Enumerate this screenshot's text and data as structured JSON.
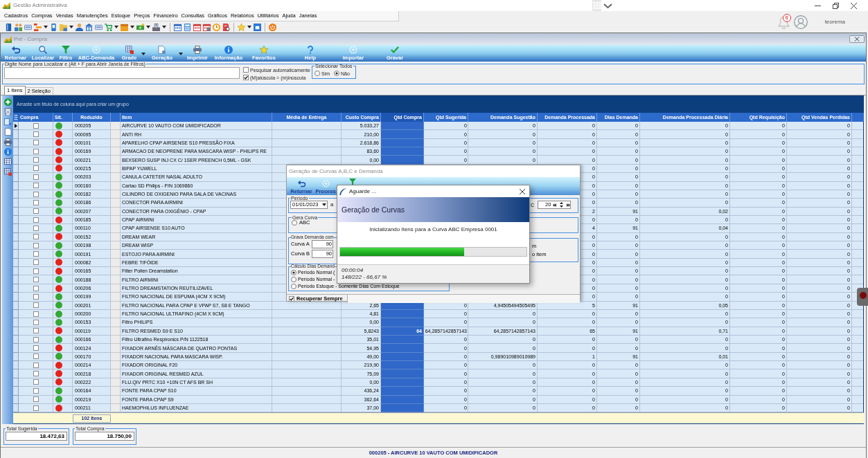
{
  "window": {
    "title": "Gestão Administrativa",
    "notifications": "0",
    "user": "teorema"
  },
  "menu": [
    "Cadastros",
    "Compras",
    "Vendas",
    "Manutenções",
    "Estoque",
    "Preços",
    "Financeiro",
    "Consultas",
    "Gráficos",
    "Relatórios",
    "Utilitários",
    "Ajuda",
    "Janelas"
  ],
  "toolbar": [
    [
      {
        "dropdown": false
      },
      {
        "dropdown": false
      },
      {
        "dropdown": false
      },
      {
        "dropdown": true
      },
      {
        "dropdown": false
      },
      {
        "dropdown": true
      },
      {
        "dropdown": false
      },
      {
        "dropdown": false
      },
      {
        "dropdown": false
      },
      {
        "dropdown": true
      },
      {
        "dropdown": true
      },
      {
        "dropdown": true
      },
      {
        "dropdown": true
      }
    ],
    [
      {
        "dropdown": false
      },
      {
        "dropdown": false
      },
      {
        "dropdown": false
      },
      {
        "dropdown": false
      },
      {
        "dropdown": false
      },
      {
        "dropdown": false
      }
    ],
    [
      {
        "dropdown": true
      },
      {
        "dropdown": false
      }
    ],
    [
      {
        "dropdown": false
      }
    ]
  ],
  "child_window": {
    "title": "Pré - Compra",
    "toolbar": [
      {
        "label": "Retornar",
        "dropdown": false
      },
      {
        "label": "Localizar",
        "dropdown": false
      },
      {
        "label": "Filtro",
        "dropdown": false
      },
      {
        "label": "ABC-Demanda",
        "dropdown": false
      },
      {
        "label": "Grade",
        "dropdown": true
      },
      {
        "label": "Geração",
        "dropdown": true
      },
      {
        "label": "Imprimir",
        "dropdown": false
      },
      {
        "label": "Informação",
        "dropdown": false
      },
      {
        "label": "Favoritos",
        "dropdown": false
      },
      {
        "label": "Help",
        "dropdown": false
      },
      {
        "label": "Importar",
        "dropdown": false
      },
      {
        "label": "Gravar",
        "dropdown": false
      }
    ]
  },
  "search": {
    "legend": "Digite Nome para Localizar e (Alt + F para Abrir Janela de Filtros)",
    "options": [
      {
        "label": "Pesquisar automaticamente",
        "checked": false
      },
      {
        "label": "(M)aiúscula = (m)inúscula",
        "checked": true
      }
    ],
    "select_all": {
      "legend": "Selecionar Todos",
      "options": [
        {
          "label": "Sim",
          "selected": false
        },
        {
          "label": "Não",
          "selected": true
        }
      ]
    }
  },
  "tabs": [
    {
      "label": "1 Itens",
      "selected": true
    },
    {
      "label": "2 Seleção",
      "selected": false
    }
  ],
  "grid": {
    "group_hint": "Arraste um título de coluna aqui para criar um grupo",
    "columns": [
      {
        "label": "Compra",
        "selected": false
      },
      {
        "label": "Sit.",
        "selected": false
      },
      {
        "label": "Reduzido",
        "selected": false
      },
      {
        "label": "Item",
        "selected": false
      },
      {
        "label": "Média de Entrega",
        "selected": false
      },
      {
        "label": "Custo Compra",
        "selected": false
      },
      {
        "label": "Qtd Compra",
        "selected": true
      },
      {
        "label": "Qtd Sugerida",
        "selected": false
      },
      {
        "label": "Demanda Sugestão",
        "selected": false
      },
      {
        "label": "Demanda Processada",
        "selected": false
      },
      {
        "label": "Dias Demanda",
        "selected": false
      },
      {
        "label": "Demanda Processada Diária",
        "selected": false
      },
      {
        "label": "Qtd Requisição",
        "selected": false
      },
      {
        "label": "Qtd Vendas Perdidas",
        "selected": false
      }
    ],
    "rows": [
      {
        "current": true,
        "compra": false,
        "color": "#35a833",
        "reduzido": "000205",
        "item": "AIRCURVE 10 VAUTO COM UMIDIFICADOR",
        "custo_compra": "5.033,27",
        "qtd_sugerida": "0",
        "demanda_sugestao": "0",
        "demanda_processada": "0",
        "dias_demanda": "0",
        "demanda_processada_diaria": "0",
        "qtd_requisicao": "0",
        "qtd_vendas_perdidas": "0"
      },
      {
        "current": false,
        "compra": false,
        "color": "#e3231c",
        "reduzido": "000095",
        "item": "ANTI RH",
        "custo_compra": "210,00",
        "qtd_sugerida": "0",
        "demanda_sugestao": "0",
        "demanda_processada": "0",
        "dias_demanda": "0",
        "demanda_processada_diaria": "0",
        "qtd_requisicao": "0",
        "qtd_vendas_perdidas": "0"
      },
      {
        "current": false,
        "compra": false,
        "color": "#e3231c",
        "reduzido": "000101",
        "item": "APARELHO CPAP AIRSENSE S10 PRESSÃO FIXA",
        "custo_compra": "2.618,86",
        "qtd_sugerida": "0",
        "demanda_sugestao": "0",
        "demanda_processada": "0",
        "dias_demanda": "0",
        "demanda_processada_diaria": "0",
        "qtd_requisicao": "0",
        "qtd_vendas_perdidas": "0"
      },
      {
        "current": false,
        "compra": false,
        "color": "#e3231c",
        "reduzido": "000169",
        "item": "ARMACAO DE NEOPRENE PARA MASCARA WISP - PHILIPS RE",
        "custo_compra": "83,60",
        "qtd_sugerida": "0",
        "demanda_sugestao": "0",
        "demanda_processada": "0",
        "dias_demanda": "0",
        "demanda_processada_diaria": "0",
        "qtd_requisicao": "0",
        "qtd_vendas_perdidas": "0"
      },
      {
        "current": false,
        "compra": false,
        "color": "#e3231c",
        "reduzido": "000221",
        "item": "BEXSERO SUSP INJ CX C/ 1SER PREENCH 0,5ML - GSK",
        "custo_compra": "0,00",
        "qtd_sugerida": "0",
        "demanda_sugestao": "0",
        "demanda_processada": "0",
        "dias_demanda": "0",
        "demanda_processada_diaria": "0",
        "qtd_requisicao": "0",
        "qtd_vendas_perdidas": "0"
      },
      {
        "current": false,
        "compra": false,
        "color": "#e3231c",
        "reduzido": "000215",
        "item": "BIPAP YUWELL",
        "demanda_processada": "0",
        "dias_demanda": "0",
        "demanda_processada_diaria": "0",
        "qtd_requisicao": "0",
        "qtd_vendas_perdidas": "0"
      },
      {
        "current": false,
        "compra": false,
        "color": "#35a833",
        "reduzido": "000203",
        "item": "CANULA CATETER NASAL ADULTO",
        "demanda_processada": "0",
        "dias_demanda": "0",
        "demanda_processada_diaria": "0",
        "qtd_requisicao": "0",
        "qtd_vendas_perdidas": "0"
      },
      {
        "current": false,
        "compra": false,
        "color": "#35a833",
        "reduzido": "000160",
        "item": "Cartao SD Philips - P/N 1069860",
        "demanda_processada": "0",
        "dias_demanda": "0",
        "demanda_processada_diaria": "0",
        "qtd_requisicao": "0",
        "qtd_vendas_perdidas": "0"
      },
      {
        "current": false,
        "compra": false,
        "color": "#35a833",
        "reduzido": "000182",
        "item": "CILINDRO DE OXIGENIO PARA SALA DE VACINAS",
        "demanda_processada": "0",
        "dias_demanda": "0",
        "demanda_processada_diaria": "0",
        "qtd_requisicao": "0",
        "qtd_vendas_perdidas": "0"
      },
      {
        "current": false,
        "compra": false,
        "color": "#35a833",
        "reduzido": "000186",
        "item": "CONECTOR PARA AIRMINI",
        "demanda_processada": "0",
        "dias_demanda": "0",
        "demanda_processada_diaria": "0",
        "qtd_requisicao": "0",
        "qtd_vendas_perdidas": "0"
      },
      {
        "current": false,
        "compra": false,
        "color": "#35a833",
        "reduzido": "000207",
        "item": "CONECTOR PARA OXIGÊNIO - CPAP",
        "demanda_processada": "2",
        "dias_demanda": "91",
        "demanda_processada_diaria": "0,02",
        "qtd_requisicao": "0",
        "qtd_vendas_perdidas": "0"
      },
      {
        "current": false,
        "compra": false,
        "color": "#e3231c",
        "reduzido": "000185",
        "item": "CPAP AIRMINI",
        "demanda_processada": "0",
        "dias_demanda": "0",
        "demanda_processada_diaria": "0",
        "qtd_requisicao": "0",
        "qtd_vendas_perdidas": "0"
      },
      {
        "current": false,
        "compra": false,
        "color": "#35a833",
        "reduzido": "000110",
        "item": "CPAP AIRSENSE S10 AUTO",
        "demanda_processada": "4",
        "dias_demanda": "91",
        "demanda_processada_diaria": "0,04",
        "qtd_requisicao": "0",
        "qtd_vendas_perdidas": "0"
      },
      {
        "current": false,
        "compra": false,
        "color": "#e3231c",
        "reduzido": "000152",
        "item": "DREAM WEAR",
        "demanda_processada": "0",
        "dias_demanda": "0",
        "demanda_processada_diaria": "0",
        "qtd_requisicao": "0",
        "qtd_vendas_perdidas": "0"
      },
      {
        "current": false,
        "compra": false,
        "color": "#35a833",
        "reduzido": "000198",
        "item": "DREAM WISP",
        "demanda_processada": "0",
        "dias_demanda": "0",
        "demanda_processada_diaria": "0",
        "qtd_requisicao": "0",
        "qtd_vendas_perdidas": "0"
      },
      {
        "current": false,
        "compra": false,
        "color": "#35a833",
        "reduzido": "000191",
        "item": "ESTOJO PARA AIRMINI",
        "demanda_processada": "0",
        "dias_demanda": "0",
        "demanda_processada_diaria": "0",
        "qtd_requisicao": "0",
        "qtd_vendas_perdidas": "0"
      },
      {
        "current": false,
        "compra": false,
        "color": "#e3231c",
        "reduzido": "000082",
        "item": "FEBRE TIFÓIDE",
        "demanda_processada": "0",
        "dias_demanda": "0",
        "demanda_processada_diaria": "0",
        "qtd_requisicao": "0",
        "qtd_vendas_perdidas": "0"
      },
      {
        "current": false,
        "compra": false,
        "color": "#e3231c",
        "reduzido": "000165",
        "item": "Filter Pollen Dreamstation",
        "demanda_processada": "0",
        "dias_demanda": "0",
        "demanda_processada_diaria": "0",
        "qtd_requisicao": "0",
        "qtd_vendas_perdidas": "0"
      },
      {
        "current": false,
        "compra": false,
        "color": "#35a833",
        "reduzido": "000188",
        "item": "FILTRO AIRMINI",
        "demanda_processada": "0",
        "dias_demanda": "0",
        "demanda_processada_diaria": "0",
        "qtd_requisicao": "0",
        "qtd_vendas_perdidas": "0"
      },
      {
        "current": false,
        "compra": false,
        "color": "#e3231c",
        "reduzido": "000206",
        "item": "FILTRO DREAMSTATION REUTILIZAVEL",
        "demanda_processada": "0",
        "dias_demanda": "0",
        "demanda_processada_diaria": "0",
        "qtd_requisicao": "0",
        "qtd_vendas_perdidas": "0"
      },
      {
        "current": false,
        "compra": false,
        "color": "#35a833",
        "reduzido": "000199",
        "item": "FILTRO NACIONAL DE ESPUMA (4CM X 9CM)",
        "demanda_processada": "0",
        "dias_demanda": "0",
        "demanda_processada_diaria": "0",
        "qtd_requisicao": "0",
        "qtd_vendas_perdidas": "0"
      },
      {
        "current": false,
        "compra": false,
        "color": "#35a833",
        "reduzido": "000201",
        "item": "FILTRO NACIONAL PARA CPAP E VPAP S7, S8 E TANGO",
        "custo_compra": "2,65",
        "qtd_sugerida": "0",
        "demanda_sugestao": "4,94505494505495",
        "demanda_processada": "5",
        "dias_demanda": "91",
        "demanda_processada_diaria": "0,05",
        "qtd_requisicao": "0",
        "qtd_vendas_perdidas": "0"
      },
      {
        "current": false,
        "compra": false,
        "color": "#35a833",
        "reduzido": "000200",
        "item": "FILTRO NACIONAL ULTRAFINO (4CM X 9CM)",
        "custo_compra": "4,81",
        "qtd_sugerida": "0",
        "demanda_sugestao": "0",
        "demanda_processada": "0",
        "dias_demanda": "0",
        "demanda_processada_diaria": "0",
        "qtd_requisicao": "0",
        "qtd_vendas_perdidas": "0"
      },
      {
        "current": false,
        "compra": false,
        "color": "#35a833",
        "reduzido": "000153",
        "item": "Filtro PHILIPS",
        "custo_compra": "0,00",
        "qtd_sugerida": "0",
        "demanda_sugestao": "0",
        "demanda_processada": "0",
        "dias_demanda": "0",
        "demanda_processada_diaria": "0",
        "qtd_requisicao": "0",
        "qtd_vendas_perdidas": "0"
      },
      {
        "current": false,
        "compra": false,
        "color": "#e3231c",
        "reduzido": "000119",
        "item": "FILTRO RESMED S9 E S10",
        "custo_compra": "5,8243",
        "qtd_compra": "64",
        "qtd_sugerida": "64,2857142857143",
        "demanda_sugestao": "64,2857142857143",
        "demanda_processada": "65",
        "dias_demanda": "91",
        "demanda_processada_diaria": "0,71",
        "qtd_requisicao": "0",
        "qtd_vendas_perdidas": "0"
      },
      {
        "current": false,
        "compra": false,
        "color": "#35a833",
        "reduzido": "000166",
        "item": "Filtro Ultrafino Respironics P/N 1122518",
        "custo_compra": "35,01",
        "qtd_sugerida": "0",
        "demanda_sugestao": "0",
        "demanda_processada": "0",
        "dias_demanda": "0",
        "demanda_processada_diaria": "0",
        "qtd_requisicao": "0",
        "qtd_vendas_perdidas": "0"
      },
      {
        "current": false,
        "compra": false,
        "color": "#e3231c",
        "reduzido": "000124",
        "item": "FIXADOR ARNÊS MÁSCARA DE QUATRO PONTAS",
        "custo_compra": "54,95",
        "qtd_sugerida": "0",
        "demanda_sugestao": "0",
        "demanda_processada": "0",
        "dias_demanda": "0",
        "demanda_processada_diaria": "0",
        "qtd_requisicao": "0",
        "qtd_vendas_perdidas": "0"
      },
      {
        "current": false,
        "compra": false,
        "color": "#35a833",
        "reduzido": "000170",
        "item": "FIXADOR NACIONAL PARA MASCARA WISP.",
        "custo_compra": "49,00",
        "qtd_sugerida": "0",
        "demanda_sugestao": "0,989010989010989",
        "demanda_processada": "1",
        "dias_demanda": "91",
        "demanda_processada_diaria": "0,01",
        "qtd_requisicao": "0",
        "qtd_vendas_perdidas": "0"
      },
      {
        "current": false,
        "compra": false,
        "color": "#e3231c",
        "reduzido": "000214",
        "item": "FIXADOR ORIGINAL F20",
        "custo_compra": "219,90",
        "qtd_sugerida": "0",
        "demanda_sugestao": "0",
        "demanda_processada": "0",
        "dias_demanda": "0",
        "demanda_processada_diaria": "0",
        "qtd_requisicao": "0",
        "qtd_vendas_perdidas": "0"
      },
      {
        "current": false,
        "compra": false,
        "color": "#e3231c",
        "reduzido": "000218",
        "item": "FIXADOR ORIGINAL RESMED AZUL",
        "custo_compra": "75,09",
        "qtd_sugerida": "0",
        "demanda_sugestao": "0",
        "demanda_processada": "0",
        "dias_demanda": "0",
        "demanda_processada_diaria": "0",
        "qtd_requisicao": "0",
        "qtd_vendas_perdidas": "0"
      },
      {
        "current": false,
        "compra": false,
        "color": "#e3231c",
        "reduzido": "000222",
        "item": "FLU.QIV PRTC X10 +10N CT AFS BR SH",
        "custo_compra": "0,00",
        "qtd_sugerida": "0",
        "demanda_sugestao": "0",
        "demanda_processada": "0",
        "dias_demanda": "0",
        "demanda_processada_diaria": "0",
        "qtd_requisicao": "0",
        "qtd_vendas_perdidas": "0"
      },
      {
        "current": false,
        "compra": false,
        "color": "#35a833",
        "reduzido": "000164",
        "item": "FONTE PARA CPAP S10",
        "custo_compra": "436,24",
        "qtd_sugerida": "0",
        "demanda_sugestao": "0",
        "demanda_processada": "0",
        "dias_demanda": "0",
        "demanda_processada_diaria": "0",
        "qtd_requisicao": "0",
        "qtd_vendas_perdidas": "0"
      },
      {
        "current": false,
        "compra": false,
        "color": "#35a833",
        "reduzido": "000219",
        "item": "FONTE PARA CPAP S9",
        "custo_compra": "362,64",
        "qtd_sugerida": "0",
        "demanda_sugestao": "0",
        "demanda_processada": "0",
        "dias_demanda": "0",
        "demanda_processada_diaria": "0",
        "qtd_requisicao": "0",
        "qtd_vendas_perdidas": "0"
      },
      {
        "current": false,
        "compra": false,
        "color": "#e3231c",
        "reduzido": "000211",
        "item": "HAEMOPHILUS INFLUENZAE",
        "custo_compra": "37,00",
        "qtd_sugerida": "0",
        "demanda_sugestao": "0",
        "demanda_processada": "0",
        "dias_demanda": "0",
        "demanda_processada_diaria": "0",
        "qtd_requisicao": "0",
        "qtd_vendas_perdidas": "0"
      }
    ],
    "footer": "102 Itens"
  },
  "totals": [
    {
      "label": "Total Sugerida",
      "value": "18.472,63"
    },
    {
      "label": "Total Compra",
      "value": "18.750,00"
    }
  ],
  "status_bar": "000205 - AIRCURVE 10 VAUTO COM UMIDIFICADOR",
  "curves_dialog": {
    "title": "Geração de Curvas A,B,C e Demanda",
    "toolbar": [
      {
        "label": "Retornar"
      },
      {
        "label": "Process"
      }
    ],
    "period": {
      "legend": "Período",
      "date": "01/01/2023",
      "separator": "a",
      "curve_c_label": "C",
      "curve_c_value": "20"
    },
    "curve_type": {
      "legend": "Gera Curva",
      "options": [
        {
          "label": "ABC",
          "selected": false
        }
      ]
    },
    "demand": {
      "legend": "Grava Demanda com",
      "fields": [
        {
          "label": "Curva A",
          "value": "90"
        },
        {
          "label": "Curva B",
          "value": "90"
        }
      ],
      "notes": [
        "m",
        "o item"
      ]
    },
    "days": {
      "legend": "Cálculo Dias Demand",
      "options": [
        {
          "label": "Período Normal (",
          "selected": true
        },
        {
          "label": "Período Normal -",
          "selected": false
        },
        {
          "label": "Período Estoque - Somente Dias Com Estoque",
          "selected": false
        }
      ]
    },
    "recover": {
      "label": "Recuperar Sempre",
      "checked": true
    }
  },
  "progress_dialog": {
    "title": "Aguarde ...",
    "heading": "Geração de Curvas",
    "message": "Inicializando Itens para a Curva ABC Empresa 0001",
    "level": 0.6667,
    "elapsed": "00:00:04",
    "progress": "148/222 - 66,67 %"
  }
}
